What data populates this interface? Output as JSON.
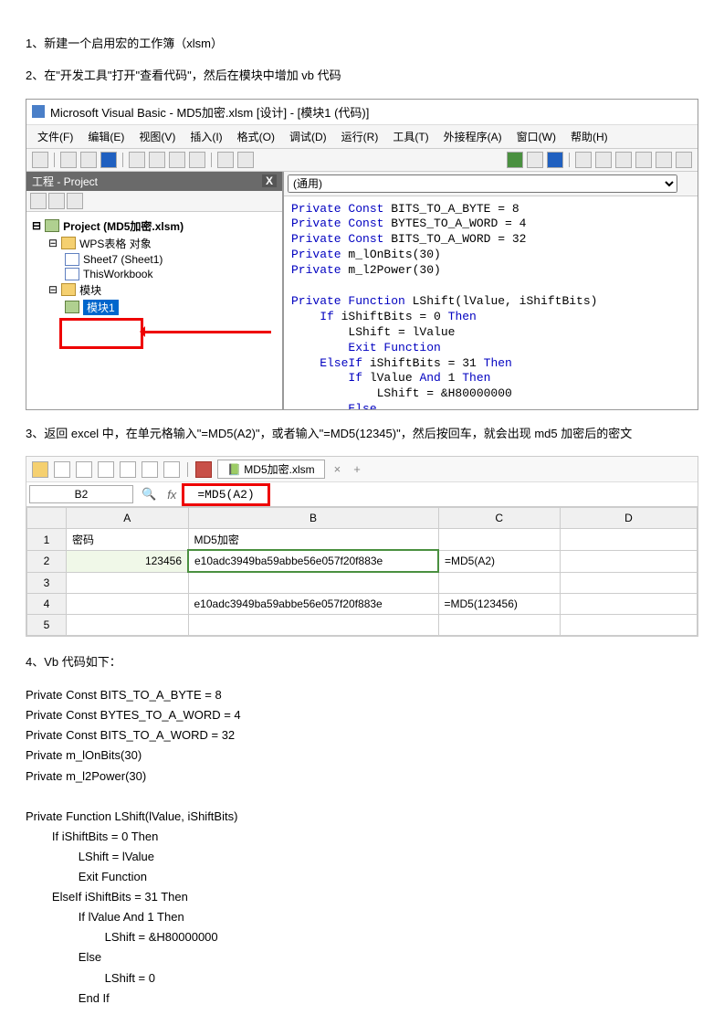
{
  "steps": {
    "s1": "1、新建一个启用宏的工作簿（xlsm）",
    "s2": "2、在\"开发工具\"打开\"查看代码\"，然后在模块中增加 vb 代码",
    "s3": "3、返回 excel 中，在单元格输入\"=MD5(A2)\"，或者输入\"=MD5(12345)\"，然后按回车，就会出现 md5 加密后的密文",
    "s4": "4、Vb 代码如下："
  },
  "vbe": {
    "title": "Microsoft Visual Basic - MD5加密.xlsm [设计] - [模块1 (代码)]",
    "menus": [
      "文件(F)",
      "编辑(E)",
      "视图(V)",
      "插入(I)",
      "格式(O)",
      "调试(D)",
      "运行(R)",
      "工具(T)",
      "外接程序(A)",
      "窗口(W)",
      "帮助(H)"
    ],
    "proj_title": "工程 - Project",
    "tree": {
      "root": "Project (MD5加密.xlsm)",
      "wps": "WPS表格 对象",
      "sheet": "Sheet7 (Sheet1)",
      "wb": "ThisWorkbook",
      "modgrp": "模块",
      "mod1": "模块1"
    },
    "dropdown": "(通用)",
    "code_lines": [
      {
        "cls": "kw",
        "t": "Private Const"
      },
      {
        "t": " BITS_TO_A_BYTE = 8\n"
      },
      {
        "cls": "kw",
        "t": "Private Const"
      },
      {
        "t": " BYTES_TO_A_WORD = 4\n"
      },
      {
        "cls": "kw",
        "t": "Private Const"
      },
      {
        "t": " BITS_TO_A_WORD = 32\n"
      },
      {
        "cls": "kw",
        "t": "Private"
      },
      {
        "t": " m_lOnBits(30)\n"
      },
      {
        "cls": "kw",
        "t": "Private"
      },
      {
        "t": " m_l2Power(30)\n\n"
      },
      {
        "cls": "kw",
        "t": "Private Function"
      },
      {
        "t": " LShift(lValue, iShiftBits)\n"
      },
      {
        "cls": "kw",
        "t": "    If"
      },
      {
        "t": " iShiftBits = 0 "
      },
      {
        "cls": "kw",
        "t": "Then"
      },
      {
        "t": "\n"
      },
      {
        "t": "        LShift = lValue\n"
      },
      {
        "cls": "kw",
        "t": "        Exit Function"
      },
      {
        "t": "\n"
      },
      {
        "cls": "kw",
        "t": "    ElseIf"
      },
      {
        "t": " iShiftBits = 31 "
      },
      {
        "cls": "kw",
        "t": "Then"
      },
      {
        "t": "\n"
      },
      {
        "cls": "kw",
        "t": "        If"
      },
      {
        "t": " lValue "
      },
      {
        "cls": "kw",
        "t": "And"
      },
      {
        "t": " 1 "
      },
      {
        "cls": "kw",
        "t": "Then"
      },
      {
        "t": "\n"
      },
      {
        "t": "            LShift = &H80000000\n"
      },
      {
        "cls": "kw",
        "t": "        Else"
      },
      {
        "t": "\n"
      }
    ]
  },
  "excel": {
    "tab": "MD5加密.xlsm",
    "namebox": "B2",
    "formula": "=MD5(A2)",
    "cols": [
      "",
      "A",
      "B",
      "C",
      "D"
    ],
    "rows": [
      {
        "n": "1",
        "a": "密码",
        "b": "MD5加密",
        "c": "",
        "align": "left"
      },
      {
        "n": "2",
        "a": "123456",
        "b": "e10adc3949ba59abbe56e057f20f883e",
        "c": "=MD5(A2)",
        "sel": true
      },
      {
        "n": "3",
        "a": "",
        "b": "",
        "c": ""
      },
      {
        "n": "4",
        "a": "",
        "b": "e10adc3949ba59abbe56e057f20f883e",
        "c": "=MD5(123456)"
      },
      {
        "n": "5",
        "a": "",
        "b": "",
        "c": ""
      }
    ]
  },
  "vbcode": [
    "Private Const BITS_TO_A_BYTE = 8",
    "Private Const BYTES_TO_A_WORD = 4",
    "Private Const BITS_TO_A_WORD = 32",
    "Private m_lOnBits(30)",
    "Private m_l2Power(30)",
    "",
    "Private Function LShift(lValue, iShiftBits)",
    "        If iShiftBits = 0 Then",
    "                LShift = lValue",
    "                Exit Function",
    "        ElseIf iShiftBits = 31 Then",
    "                If lValue And 1 Then",
    "                        LShift = &H80000000",
    "                Else",
    "                        LShift = 0",
    "                End If"
  ]
}
